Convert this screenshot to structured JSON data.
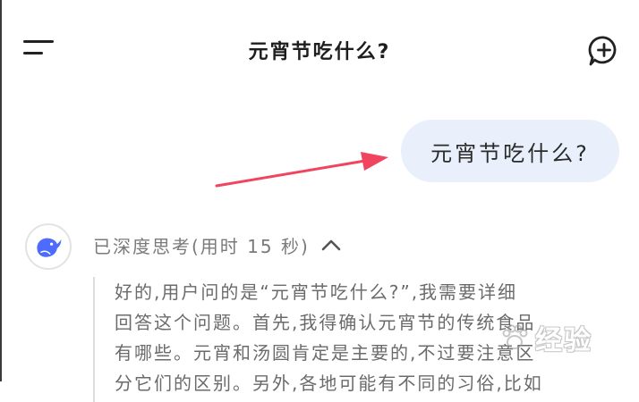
{
  "header": {
    "title": "元宵节吃什么?",
    "menu_icon": "menu-icon",
    "new_chat_icon": "chat-plus-icon"
  },
  "conversation": {
    "user_message": "元宵节吃什么?",
    "assistant": {
      "avatar_icon": "deepseek-whale-icon",
      "thinking_label": "已深度思考(用时 15 秒)",
      "collapse_icon": "chevron-up-icon",
      "thinking_lines": [
        "好的,用户问的是“元宵节吃什么?”,我需要详细",
        "回答这个问题。首先,我得确认元宵节的传统食品",
        "有哪些。元宵和汤圆肯定是主要的,不过要注意区",
        "分它们的区别。另外,各地可能有不同的习俗,比如"
      ]
    }
  },
  "watermark": {
    "text": "经验"
  },
  "colors": {
    "user_bubble": "#e9f0fc",
    "arrow": "#f0445f",
    "brand_blue": "#4d6bfe",
    "thinking_text": "#6b6b6b"
  }
}
